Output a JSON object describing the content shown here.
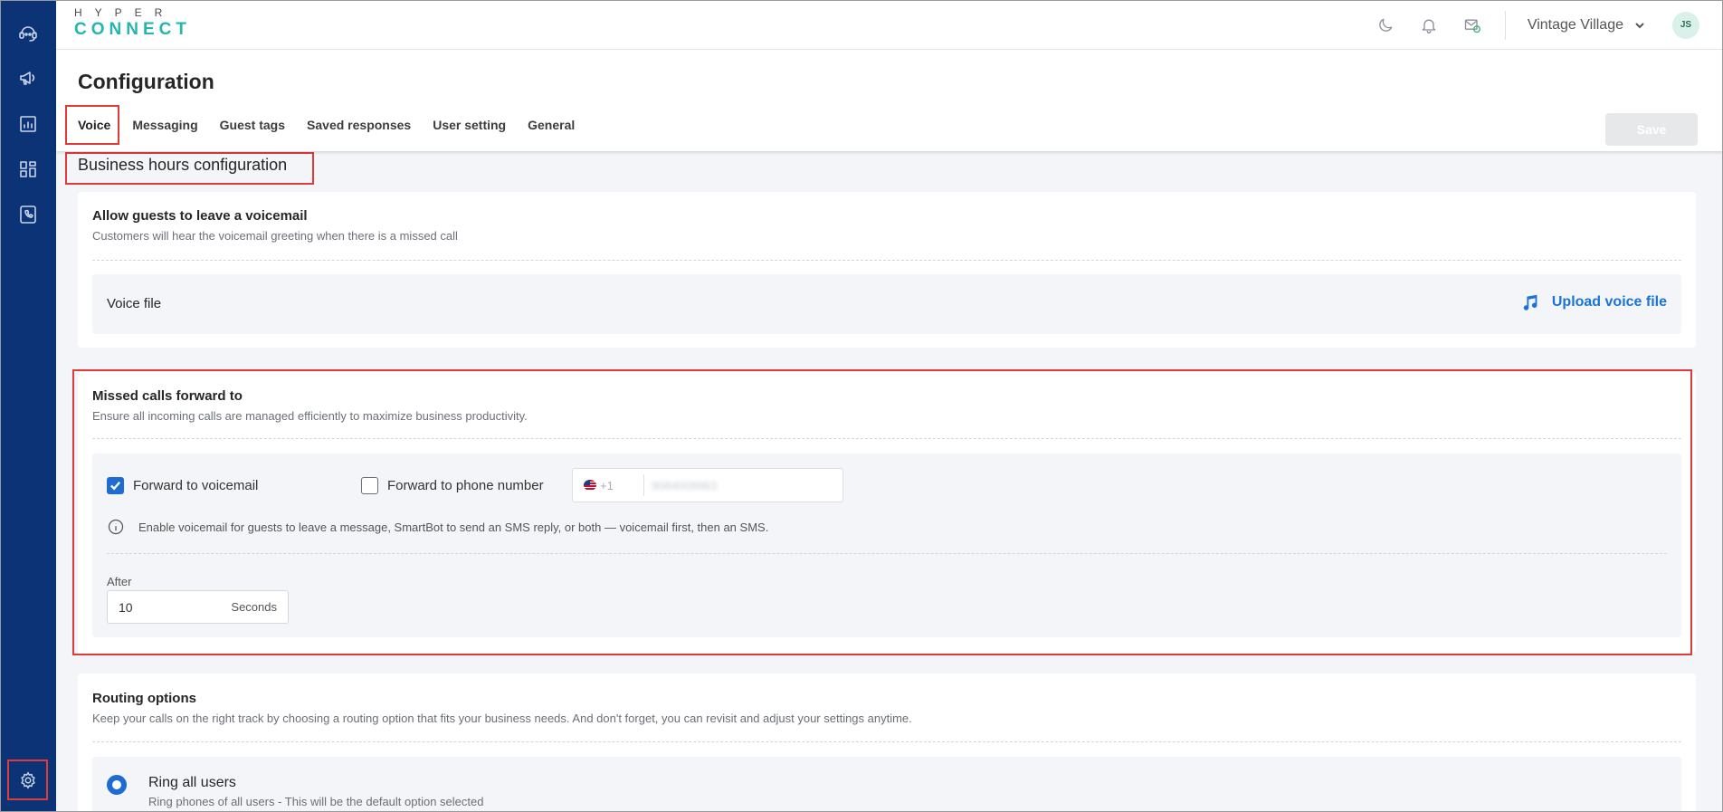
{
  "brand": {
    "top": "HYPER",
    "bottom": "CONNECT"
  },
  "header": {
    "location": "Vintage Village",
    "avatar_initials": "JS"
  },
  "page": {
    "title": "Configuration"
  },
  "tabs": [
    {
      "label": "Voice"
    },
    {
      "label": "Messaging"
    },
    {
      "label": "Guest tags"
    },
    {
      "label": "Saved responses"
    },
    {
      "label": "User setting"
    },
    {
      "label": "General"
    }
  ],
  "save_label": "Save",
  "section_title": "Business hours configuration",
  "voicemail": {
    "title": "Allow guests to leave a voicemail",
    "subtitle": "Customers will hear the voicemail greeting when there is a missed call",
    "voice_file_label": "Voice file",
    "upload_label": "Upload voice file"
  },
  "missed": {
    "title": "Missed calls forward to",
    "subtitle": "Ensure all incoming calls are managed efficiently to maximize business productivity.",
    "forward_voicemail": "Forward to voicemail",
    "forward_phone": "Forward to phone number",
    "dial_code": "+1",
    "phone_number": "9084009963",
    "info": "Enable voicemail for guests to leave a message, SmartBot to send an SMS reply, or both — voicemail first, then an SMS.",
    "after_label": "After",
    "after_value": "10",
    "after_unit": "Seconds"
  },
  "routing": {
    "title": "Routing options",
    "subtitle": "Keep your calls on the right track by choosing a routing option that fits your business needs. And don't forget, you can revisit and adjust your settings anytime.",
    "option_label": "Ring all users",
    "option_sub": "Ring phones of all users - This will be the default option selected"
  },
  "colors": {
    "sidebar": "#0b3375",
    "accent": "#1f6cd1",
    "highlight": "#e03b3b",
    "brand_teal": "#26b5ad"
  }
}
